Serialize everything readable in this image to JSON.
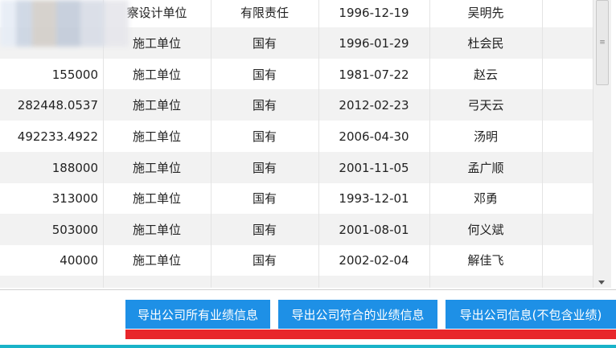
{
  "table": {
    "rows": [
      [
        "",
        "察设计单位",
        "有限责任",
        "1996-12-19",
        "吴明先"
      ],
      [
        "",
        "施工单位",
        "国有",
        "1996-01-29",
        "杜会民"
      ],
      [
        "155000",
        "施工单位",
        "国有",
        "1981-07-22",
        "赵云"
      ],
      [
        "282448.0537",
        "施工单位",
        "国有",
        "2012-02-23",
        "弓天云"
      ],
      [
        "492233.4922",
        "施工单位",
        "国有",
        "2006-04-30",
        "汤明"
      ],
      [
        "188000",
        "施工单位",
        "国有",
        "2001-11-05",
        "孟广顺"
      ],
      [
        "313000",
        "施工单位",
        "国有",
        "1993-12-01",
        "邓勇"
      ],
      [
        "503000",
        "施工单位",
        "国有",
        "2001-08-01",
        "何义斌"
      ],
      [
        "40000",
        "施工单位",
        "国有",
        "2002-02-04",
        "解佳飞"
      ]
    ]
  },
  "buttons": {
    "export_all": "导出公司所有业绩信息",
    "export_matching": "导出公司符合的业绩信息",
    "export_info": "导出公司信息(不包含业绩)"
  },
  "colors": {
    "button_bg": "#1e90e6",
    "accent_red": "#e8262b",
    "accent_cyan": "#19b3c8"
  }
}
